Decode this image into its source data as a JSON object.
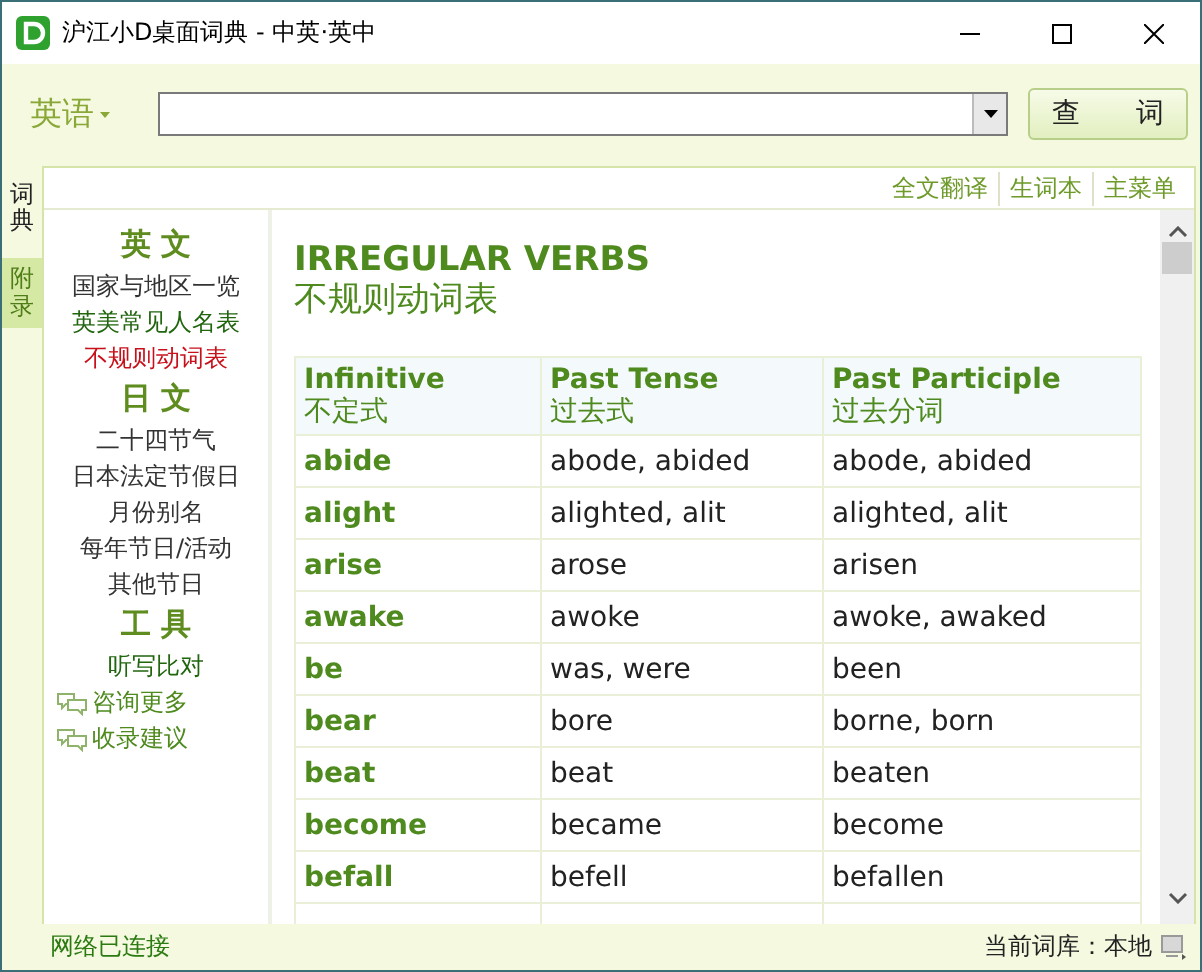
{
  "window": {
    "title": "沪江小D桌面词典 - 中英·英中"
  },
  "toolbar": {
    "language": "英语",
    "search_button": "查　　词"
  },
  "side_tabs": [
    {
      "label": "词典",
      "selected": false
    },
    {
      "label": "附录",
      "selected": true
    }
  ],
  "top_links": [
    "全文翻译",
    "生词本",
    "主菜单"
  ],
  "sidebar": {
    "sections": [
      {
        "heading": "英 文",
        "items": [
          {
            "label": "国家与地区一览",
            "visited": false,
            "selected": false
          },
          {
            "label": "英美常见人名表",
            "visited": true,
            "selected": false
          },
          {
            "label": "不规则动词表",
            "visited": false,
            "selected": true
          }
        ]
      },
      {
        "heading": "日 文",
        "items": [
          {
            "label": "二十四节气",
            "visited": false,
            "selected": false
          },
          {
            "label": "日本法定节假日",
            "visited": false,
            "selected": false
          },
          {
            "label": "月份别名",
            "visited": false,
            "selected": false
          },
          {
            "label": "每年节日/活动",
            "visited": false,
            "selected": false
          },
          {
            "label": "其他节日",
            "visited": false,
            "selected": false
          }
        ]
      },
      {
        "heading": "工 具",
        "items": [
          {
            "label": "听写比对",
            "visited": true,
            "selected": false
          }
        ]
      }
    ],
    "feedback_links": [
      "咨询更多",
      "收录建议"
    ]
  },
  "article": {
    "title": "IRREGULAR VERBS",
    "subtitle": "不规则动词表",
    "table": {
      "columns": [
        {
          "en": "Infinitive",
          "zh": "不定式"
        },
        {
          "en": "Past Tense",
          "zh": "过去式"
        },
        {
          "en": "Past Participle",
          "zh": "过去分词"
        }
      ],
      "rows": [
        [
          "abide",
          "abode, abided",
          "abode, abided"
        ],
        [
          "alight",
          "alighted, alit",
          "alighted, alit"
        ],
        [
          "arise",
          "arose",
          "arisen"
        ],
        [
          "awake",
          "awoke",
          "awoke, awaked"
        ],
        [
          "be",
          "was, were",
          "been"
        ],
        [
          "bear",
          "bore",
          "borne, born"
        ],
        [
          "beat",
          "beat",
          "beaten"
        ],
        [
          "become",
          "became",
          "become"
        ],
        [
          "befall",
          "befell",
          "befallen"
        ]
      ]
    }
  },
  "status_bar": {
    "network": "网络已连接",
    "library": "当前词库：本地"
  }
}
